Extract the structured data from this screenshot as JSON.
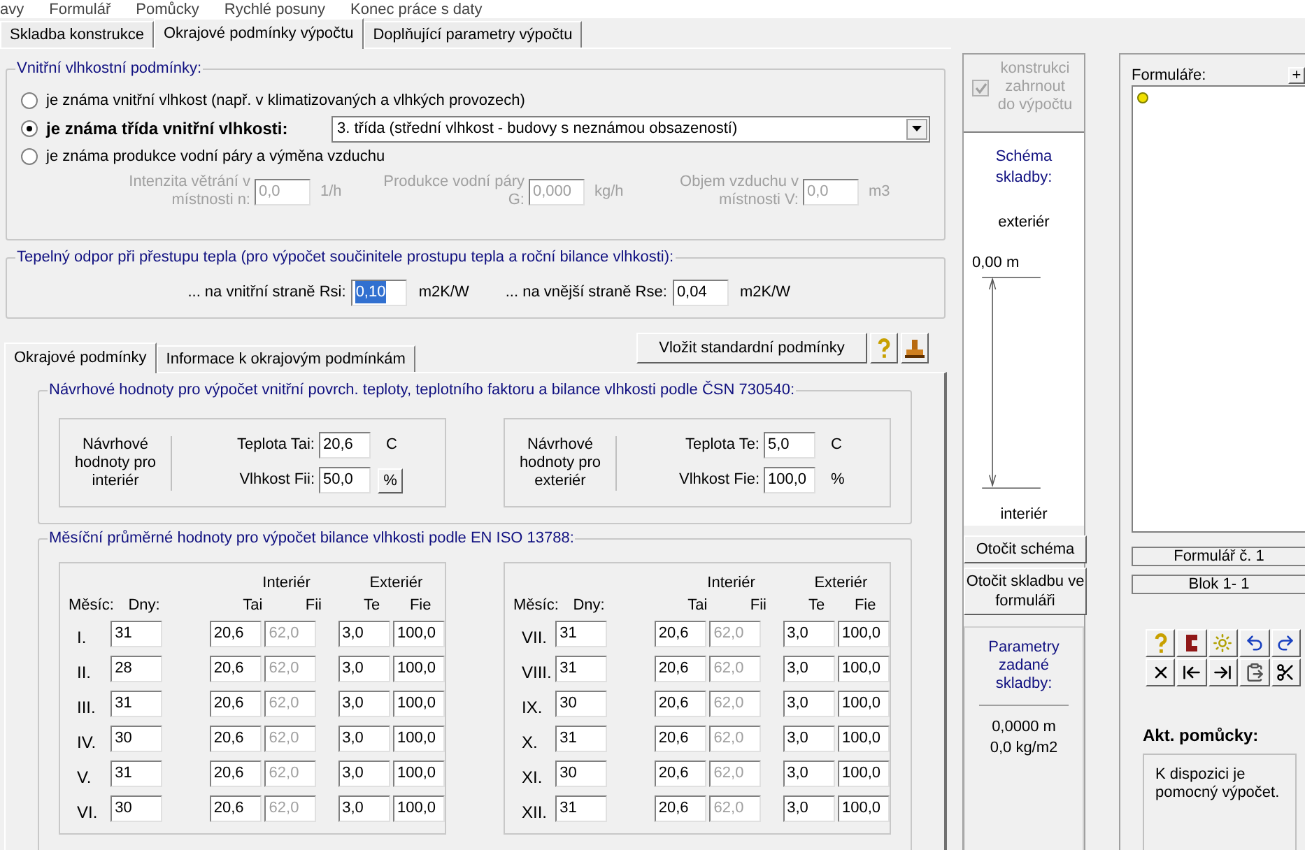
{
  "menu": [
    "avy",
    "Formulář",
    "Pomůcky",
    "Rychlé posuny",
    "Konec práce s daty"
  ],
  "main_tabs": [
    {
      "label": "Skladba konstrukce",
      "selected": false
    },
    {
      "label": "Okrajové podmínky výpočtu",
      "selected": true
    },
    {
      "label": "Doplňující parametry výpočtu",
      "selected": false
    }
  ],
  "humidity": {
    "title": "Vnitřní vlhkostní podmínky:",
    "options": [
      {
        "label": "je známa vnitřní vlhkost (např. v klimatizovaných a vlhkých provozech)",
        "selected": false
      },
      {
        "label": "je známa třída vnitřní vlhkosti:",
        "selected": true
      },
      {
        "label": "je známa produkce vodní páry a výměna vzduchu",
        "selected": false
      }
    ],
    "humidity_class": "3. třída (střední vlhkost - budovy s neznámou obsazeností)",
    "fields": [
      {
        "label": "Intenzita větrání v místnosti n:",
        "value": "0,0",
        "unit": "1/h",
        "disabled": true
      },
      {
        "label": "Produkce vodní páry G:",
        "value": "0,000",
        "unit": "kg/h",
        "disabled": true
      },
      {
        "label": "Objem vzduchu v místnosti V:",
        "value": "0,0",
        "unit": "m3",
        "disabled": true
      }
    ]
  },
  "resistance": {
    "title": "Tepelný odpor při přestupu tepla (pro výpočet součinitele prostupu tepla a roční bilance vlhkosti):",
    "fields": [
      {
        "label": "... na vnitřní straně Rsi:",
        "value": "0,10",
        "unit": "m2K/W",
        "selected": true
      },
      {
        "label": "... na vnější straně Rse:",
        "value": "0,04",
        "unit": "m2K/W",
        "selected": false
      }
    ]
  },
  "sub_tabs": [
    {
      "label": "Okrajové podmínky",
      "selected": true
    },
    {
      "label": "Informace k okrajovým podmínkám",
      "selected": false
    }
  ],
  "standard_button": "Vložit standardní podmínky",
  "design": {
    "title": "Návrhové hodnoty pro výpočet vnitřní povrch. teploty, teplotního faktoru a bilance vlhkosti podle ČSN 730540:",
    "sides": [
      {
        "caption": "Návrhové hodnoty pro interiér",
        "fields": [
          {
            "label": "Teplota Tai:",
            "value": "20,6",
            "unit": "C",
            "kind": "text"
          },
          {
            "label": "Vlhkost Fii:",
            "value": "50,0",
            "unit": "%",
            "kind": "button"
          }
        ]
      },
      {
        "caption": "Návrhové hodnoty pro exteriér",
        "fields": [
          {
            "label": "Teplota Te:",
            "value": "5,0",
            "unit": "C",
            "kind": "text"
          },
          {
            "label": "Vlhkost Fie:",
            "value": "100,0",
            "unit": "%",
            "kind": "text"
          }
        ]
      }
    ]
  },
  "monthly": {
    "title": "Měsíční průměrné hodnoty pro výpočet bilance vlhkosti podle EN ISO 13788:",
    "halves": [
      {
        "groups": [
          "Interiér",
          "Exteriér"
        ],
        "columns": [
          "Měsíc:",
          "Dny:",
          "Tai",
          "Fii",
          "Te",
          "Fie"
        ],
        "rows": [
          {
            "month": "I.",
            "days": "31",
            "tai": "20,6",
            "fii": "62,0",
            "te": "3,0",
            "fie": "100,0"
          },
          {
            "month": "II.",
            "days": "28",
            "tai": "20,6",
            "fii": "62,0",
            "te": "3,0",
            "fie": "100,0"
          },
          {
            "month": "III.",
            "days": "31",
            "tai": "20,6",
            "fii": "62,0",
            "te": "3,0",
            "fie": "100,0"
          },
          {
            "month": "IV.",
            "days": "30",
            "tai": "20,6",
            "fii": "62,0",
            "te": "3,0",
            "fie": "100,0"
          },
          {
            "month": "V.",
            "days": "31",
            "tai": "20,6",
            "fii": "62,0",
            "te": "3,0",
            "fie": "100,0"
          },
          {
            "month": "VI.",
            "days": "30",
            "tai": "20,6",
            "fii": "62,0",
            "te": "3,0",
            "fie": "100,0"
          }
        ]
      },
      {
        "groups": [
          "Interiér",
          "Exteriér"
        ],
        "columns": [
          "Měsíc:",
          "Dny:",
          "Tai",
          "Fii",
          "Te",
          "Fie"
        ],
        "rows": [
          {
            "month": "VII.",
            "days": "31",
            "tai": "20,6",
            "fii": "62,0",
            "te": "3,0",
            "fie": "100,0"
          },
          {
            "month": "VIII.",
            "days": "31",
            "tai": "20,6",
            "fii": "62,0",
            "te": "3,0",
            "fie": "100,0"
          },
          {
            "month": "IX.",
            "days": "30",
            "tai": "20,6",
            "fii": "62,0",
            "te": "3,0",
            "fie": "100,0"
          },
          {
            "month": "X.",
            "days": "31",
            "tai": "20,6",
            "fii": "62,0",
            "te": "3,0",
            "fie": "100,0"
          },
          {
            "month": "XI.",
            "days": "30",
            "tai": "20,6",
            "fii": "62,0",
            "te": "3,0",
            "fie": "100,0"
          },
          {
            "month": "XII.",
            "days": "31",
            "tai": "20,6",
            "fii": "62,0",
            "te": "3,0",
            "fie": "100,0"
          }
        ]
      }
    ]
  },
  "include": {
    "label": "konstrukci zahrnout do výpočtu",
    "checked": true,
    "disabled": true
  },
  "schema": {
    "title": "Schéma skladby:",
    "top_label": "exteriér",
    "position": "0,00 m",
    "bottom_label": "interiér"
  },
  "schema_buttons": [
    "Otočit schéma",
    "Otočit skladbu ve formuláři"
  ],
  "parameters": {
    "title": "Parametry zadané skladby:",
    "values": [
      "0,0000 m",
      "0,0 kg/m2"
    ]
  },
  "forms": {
    "title": "Formuláře:",
    "add": "+",
    "form_number": "Formulář č. 1",
    "block": "Blok 1- 1"
  },
  "tools": {
    "title": "Akt. pomůcky:",
    "text": "K dispozici je pomocný výpočet."
  }
}
